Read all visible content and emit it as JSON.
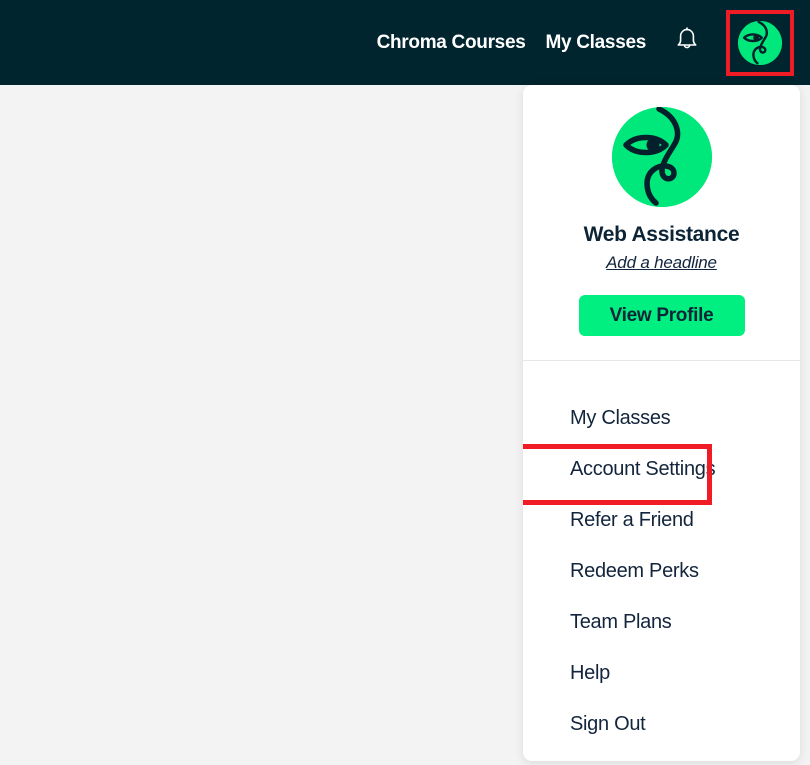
{
  "colors": {
    "header_bg": "#00252f",
    "page_bg": "#f3f3f3",
    "accent_green": "#00ef80",
    "avatar_green": "#00e87b",
    "text_dark": "#13253c",
    "annotation_red": "#ef1c25",
    "panel_bg": "#ffffff"
  },
  "header": {
    "nav_links": [
      {
        "label": "Chroma Courses",
        "name": "nav-link-chroma-courses"
      },
      {
        "label": "My Classes",
        "name": "nav-link-my-classes"
      }
    ],
    "notifications_icon": "bell-icon",
    "avatar_icon": "user-avatar-icon",
    "avatar_alt": "Web Assistance avatar"
  },
  "dropdown": {
    "profile": {
      "avatar_icon": "user-avatar-icon",
      "name": "Web Assistance",
      "headline": "Add a headline",
      "view_profile_label": "View Profile"
    },
    "menu_items": [
      {
        "label": "My Classes",
        "name": "menu-item-my-classes",
        "highlighted": false
      },
      {
        "label": "Account Settings",
        "name": "menu-item-account-settings",
        "highlighted": true
      },
      {
        "label": "Refer a Friend",
        "name": "menu-item-refer-a-friend",
        "highlighted": false
      },
      {
        "label": "Redeem Perks",
        "name": "menu-item-redeem-perks",
        "highlighted": false
      },
      {
        "label": "Team Plans",
        "name": "menu-item-team-plans",
        "highlighted": false
      },
      {
        "label": "Help",
        "name": "menu-item-help",
        "highlighted": false
      },
      {
        "label": "Sign Out",
        "name": "menu-item-sign-out",
        "highlighted": false
      }
    ]
  }
}
